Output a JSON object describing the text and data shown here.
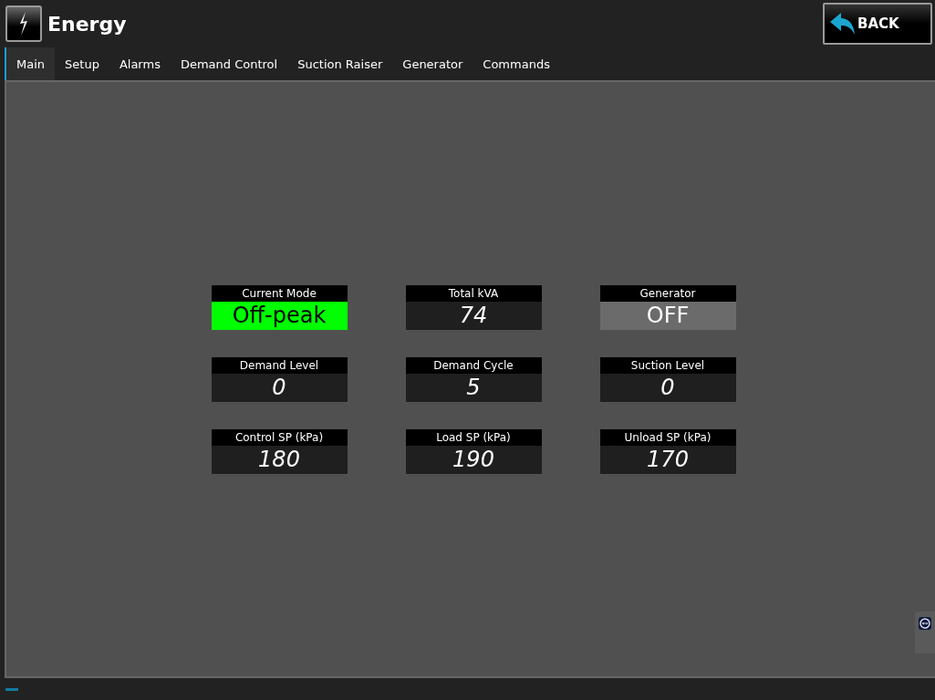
{
  "header": {
    "title": "Energy",
    "back_button": "BACK"
  },
  "tabs": [
    {
      "label": "Main",
      "selected": true
    },
    {
      "label": "Setup",
      "selected": false
    },
    {
      "label": "Alarms",
      "selected": false
    },
    {
      "label": "Demand Control",
      "selected": false
    },
    {
      "label": "Suction Raiser",
      "selected": false
    },
    {
      "label": "Generator",
      "selected": false
    },
    {
      "label": "Commands",
      "selected": false
    }
  ],
  "tiles": [
    {
      "label": "Current Mode",
      "value": "Off-peak",
      "kind": "mode"
    },
    {
      "label": "Total kVA",
      "value": "74",
      "kind": "number"
    },
    {
      "label": "Generator",
      "value": "OFF",
      "kind": "status"
    },
    {
      "label": "Demand Level",
      "value": "0",
      "kind": "number"
    },
    {
      "label": "Demand Cycle",
      "value": "5",
      "kind": "number"
    },
    {
      "label": "Suction Level",
      "value": "0",
      "kind": "number"
    },
    {
      "label": "Control SP (kPa)",
      "value": "180",
      "kind": "number"
    },
    {
      "label": "Load SP (kPa)",
      "value": "190",
      "kind": "number"
    },
    {
      "label": "Unload SP (kPa)",
      "value": "170",
      "kind": "number"
    }
  ]
}
